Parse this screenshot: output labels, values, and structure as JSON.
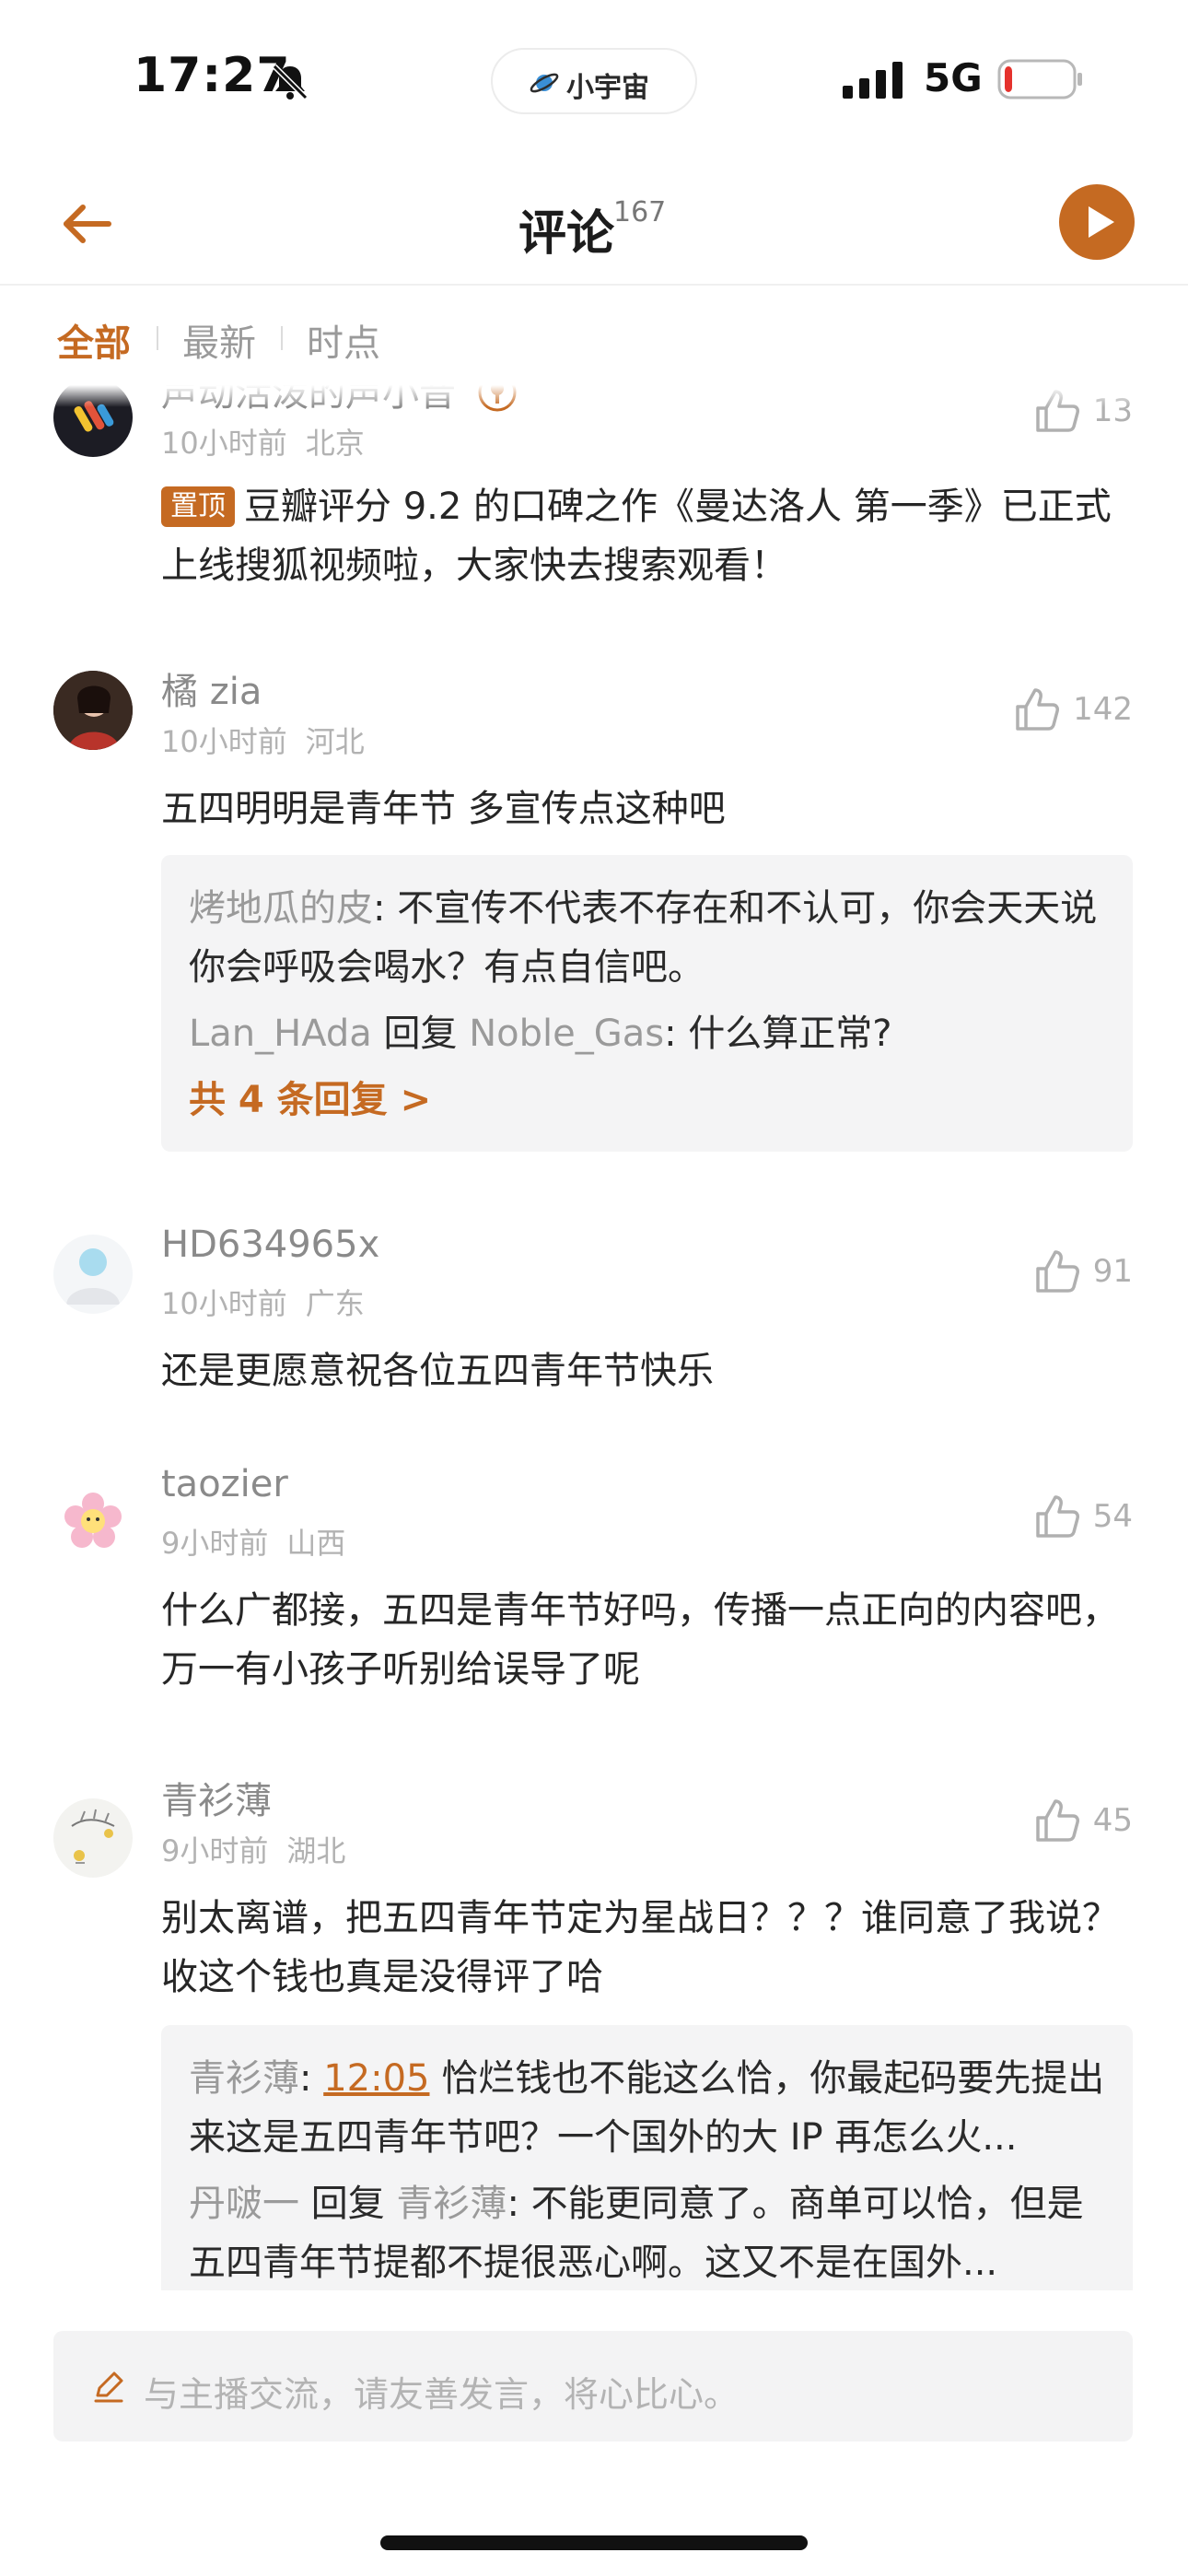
{
  "status_bar": {
    "time": "17:27",
    "island_text": "小宇宙",
    "network": "5G",
    "battery_level": 0.12,
    "battery_color": "#e5322d"
  },
  "header": {
    "title": "评论",
    "count": "167"
  },
  "tabs": [
    {
      "label": "全部",
      "active": true
    },
    {
      "label": "最新",
      "active": false
    },
    {
      "label": "时点",
      "active": false
    }
  ],
  "comments": [
    {
      "username": "声动活泼的声小音",
      "time": "10小时前",
      "location": "北京",
      "likes": "13",
      "pinned_tag": "置顶",
      "text": "豆瓣评分 9.2 的口碑之作《曼达洛人 第一季》已正式上线搜狐视频啦，大家快去搜索观看！"
    },
    {
      "username": "橘 zia",
      "time": "10小时前",
      "location": "河北",
      "likes": "142",
      "text": "五四明明是青年节 多宣传点这种吧",
      "replies": [
        {
          "user": "烤地瓜的皮",
          "text": ": 不宣传不代表不存在和不认可，你会天天说你会呼吸会喝水？有点自信吧。"
        },
        {
          "user": "Lan_HAda",
          "verb": " 回复 ",
          "target": "Noble_Gas",
          "text": ": 什么算正常?"
        }
      ],
      "more_replies": "共 4 条回复 >"
    },
    {
      "username": "HD634965x",
      "time": "10小时前",
      "location": "广东",
      "likes": "91",
      "text": "还是更愿意祝各位五四青年节快乐"
    },
    {
      "username": "taozier",
      "time": "9小时前",
      "location": "山西",
      "likes": "54",
      "text": "什么广都接，五四是青年节好吗，传播一点正向的内容吧，万一有小孩子听别给误导了呢"
    },
    {
      "username": "青衫薄",
      "time": "9小时前",
      "location": "湖北",
      "likes": "45",
      "text": "别太离谱，把五四青年节定为星战日？？？谁同意了我说？收这个钱也真是没得评了哈",
      "replies": [
        {
          "user": "青衫薄",
          "timestamp": "12:05",
          "text": " 恰烂钱也不能这么恰，你最起码要先提出来这是五四青年节吧？一个国外的大 IP 再怎么火..."
        },
        {
          "user": "丹啵一",
          "verb": " 回复 ",
          "target": "青衫薄",
          "text": ": 不能更同意了。商单可以恰，但是五四青年节提都不提很恶心啊。这又不是在国外..."
        }
      ]
    }
  ],
  "input": {
    "placeholder": "与主播交流，请友善发言，将心比心。"
  },
  "colors": {
    "accent": "#c56a22",
    "reply_bg": "#f4f4f5",
    "muted": "#9a9a9a"
  }
}
